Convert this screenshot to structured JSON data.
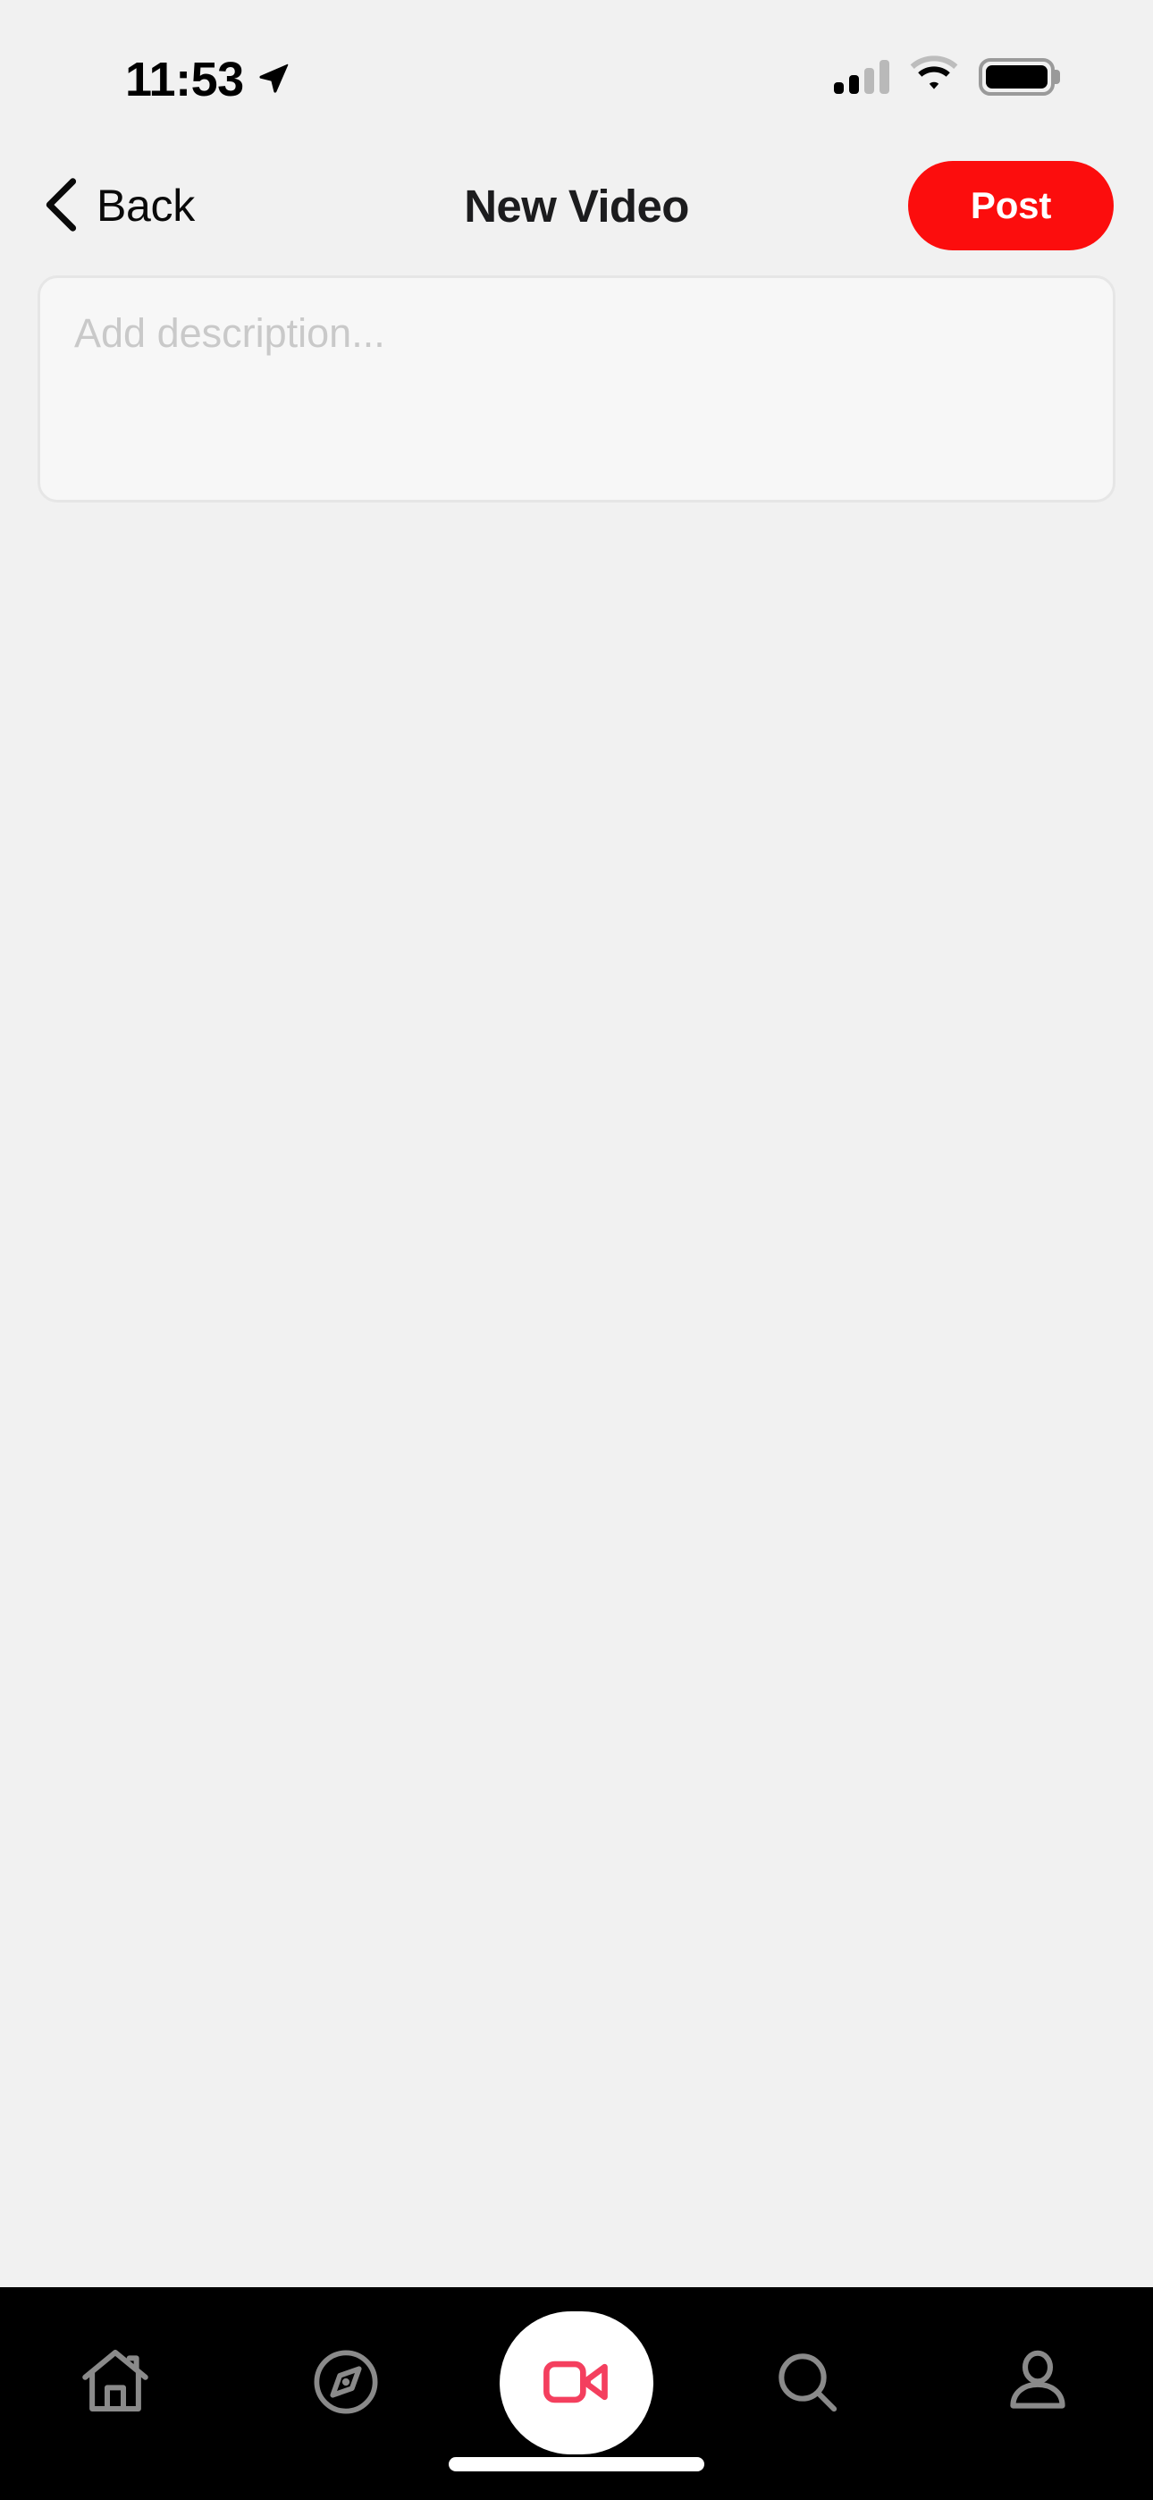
{
  "status_bar": {
    "time": "11:53",
    "location_icon": "location-arrow-icon",
    "cellular_icon": "cellular-signal-icon",
    "cellular_bars_filled": 2,
    "cellular_bars_total": 4,
    "wifi_icon": "wifi-icon",
    "battery_icon": "battery-icon",
    "battery_level_percent": 100
  },
  "header": {
    "back_label": "Back",
    "back_icon": "chevron-left-icon",
    "title": "New Video",
    "post_label": "Post",
    "post_color": "#FC0D0D",
    "post_text_color": "#FFFFFF"
  },
  "composer": {
    "description_value": "",
    "description_placeholder": "Add description...",
    "field_background": "#F7F7F7",
    "field_border": "#E6E6E6",
    "placeholder_color": "#C9C9C9"
  },
  "page": {
    "background": "#F1F1F1"
  },
  "tab_bar": {
    "background": "#000000",
    "inactive_color": "#8A8A8A",
    "active_color": "#F43F5E",
    "active_pill_background": "#FFFFFF",
    "active_index": 2,
    "items": [
      {
        "name": "home",
        "icon": "home-icon",
        "active": false
      },
      {
        "name": "explore",
        "icon": "compass-icon",
        "active": false
      },
      {
        "name": "create",
        "icon": "video-camera-icon",
        "active": true
      },
      {
        "name": "search",
        "icon": "search-icon",
        "active": false
      },
      {
        "name": "profile",
        "icon": "person-icon",
        "active": false
      }
    ],
    "home_indicator": "home-indicator"
  }
}
